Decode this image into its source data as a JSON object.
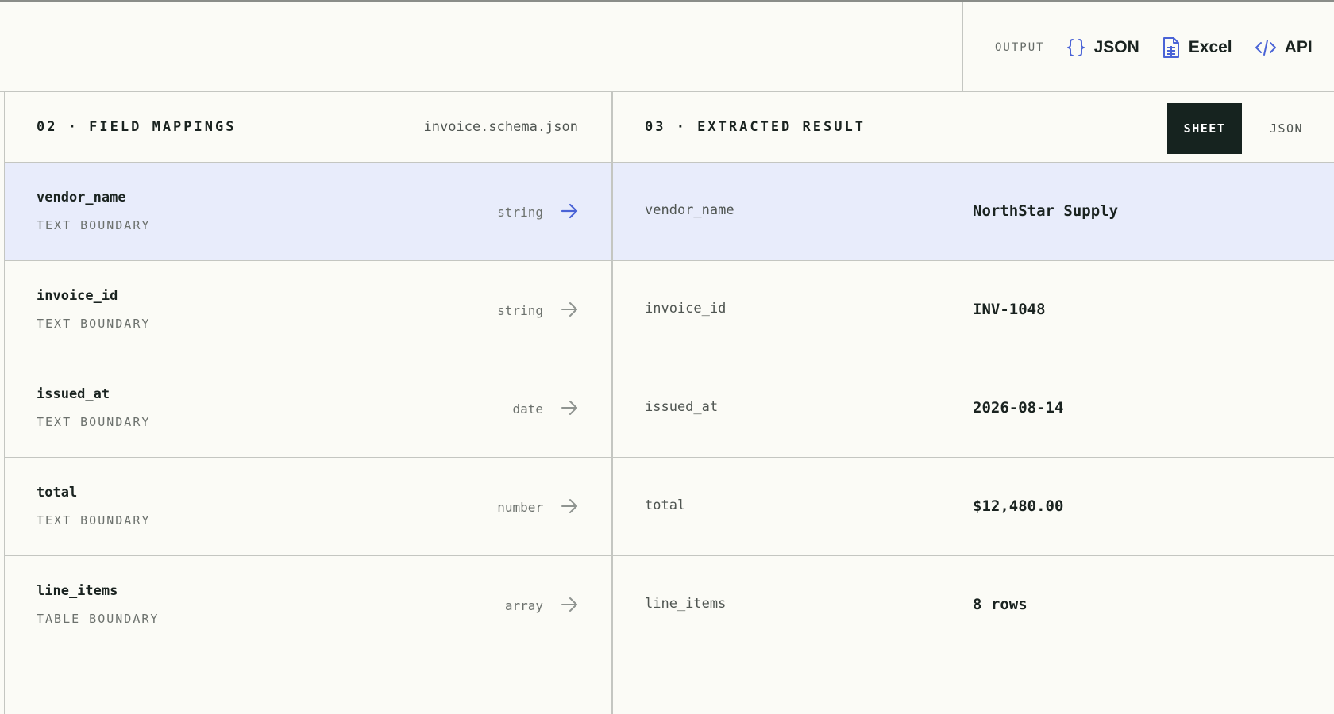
{
  "output": {
    "label": "OUTPUT",
    "items": [
      {
        "label": "JSON",
        "icon": "braces-icon"
      },
      {
        "label": "Excel",
        "icon": "spreadsheet-file-icon"
      },
      {
        "label": "API",
        "icon": "code-icon"
      }
    ]
  },
  "mappings": {
    "title": "02 · FIELD MAPPINGS",
    "schema_file": "invoice.schema.json",
    "rows": [
      {
        "name": "vendor_name",
        "boundary": "TEXT BOUNDARY",
        "type": "string"
      },
      {
        "name": "invoice_id",
        "boundary": "TEXT BOUNDARY",
        "type": "string"
      },
      {
        "name": "issued_at",
        "boundary": "TEXT BOUNDARY",
        "type": "date"
      },
      {
        "name": "total",
        "boundary": "TEXT BOUNDARY",
        "type": "number"
      },
      {
        "name": "line_items",
        "boundary": "TABLE BOUNDARY",
        "type": "array"
      }
    ]
  },
  "result": {
    "title": "03 · EXTRACTED RESULT",
    "view_sheet": "SHEET",
    "view_json": "JSON",
    "rows": [
      {
        "key": "vendor_name",
        "value": "NorthStar Supply"
      },
      {
        "key": "invoice_id",
        "value": "INV-1048"
      },
      {
        "key": "issued_at",
        "value": "2026-08-14"
      },
      {
        "key": "total",
        "value": "$12,480.00"
      },
      {
        "key": "line_items",
        "value": "8 rows"
      }
    ]
  },
  "colors": {
    "accent": "#4a63d6",
    "selected_row": "#e8ecfb",
    "active_toggle": "#16231f",
    "background": "#fbfbf6"
  }
}
